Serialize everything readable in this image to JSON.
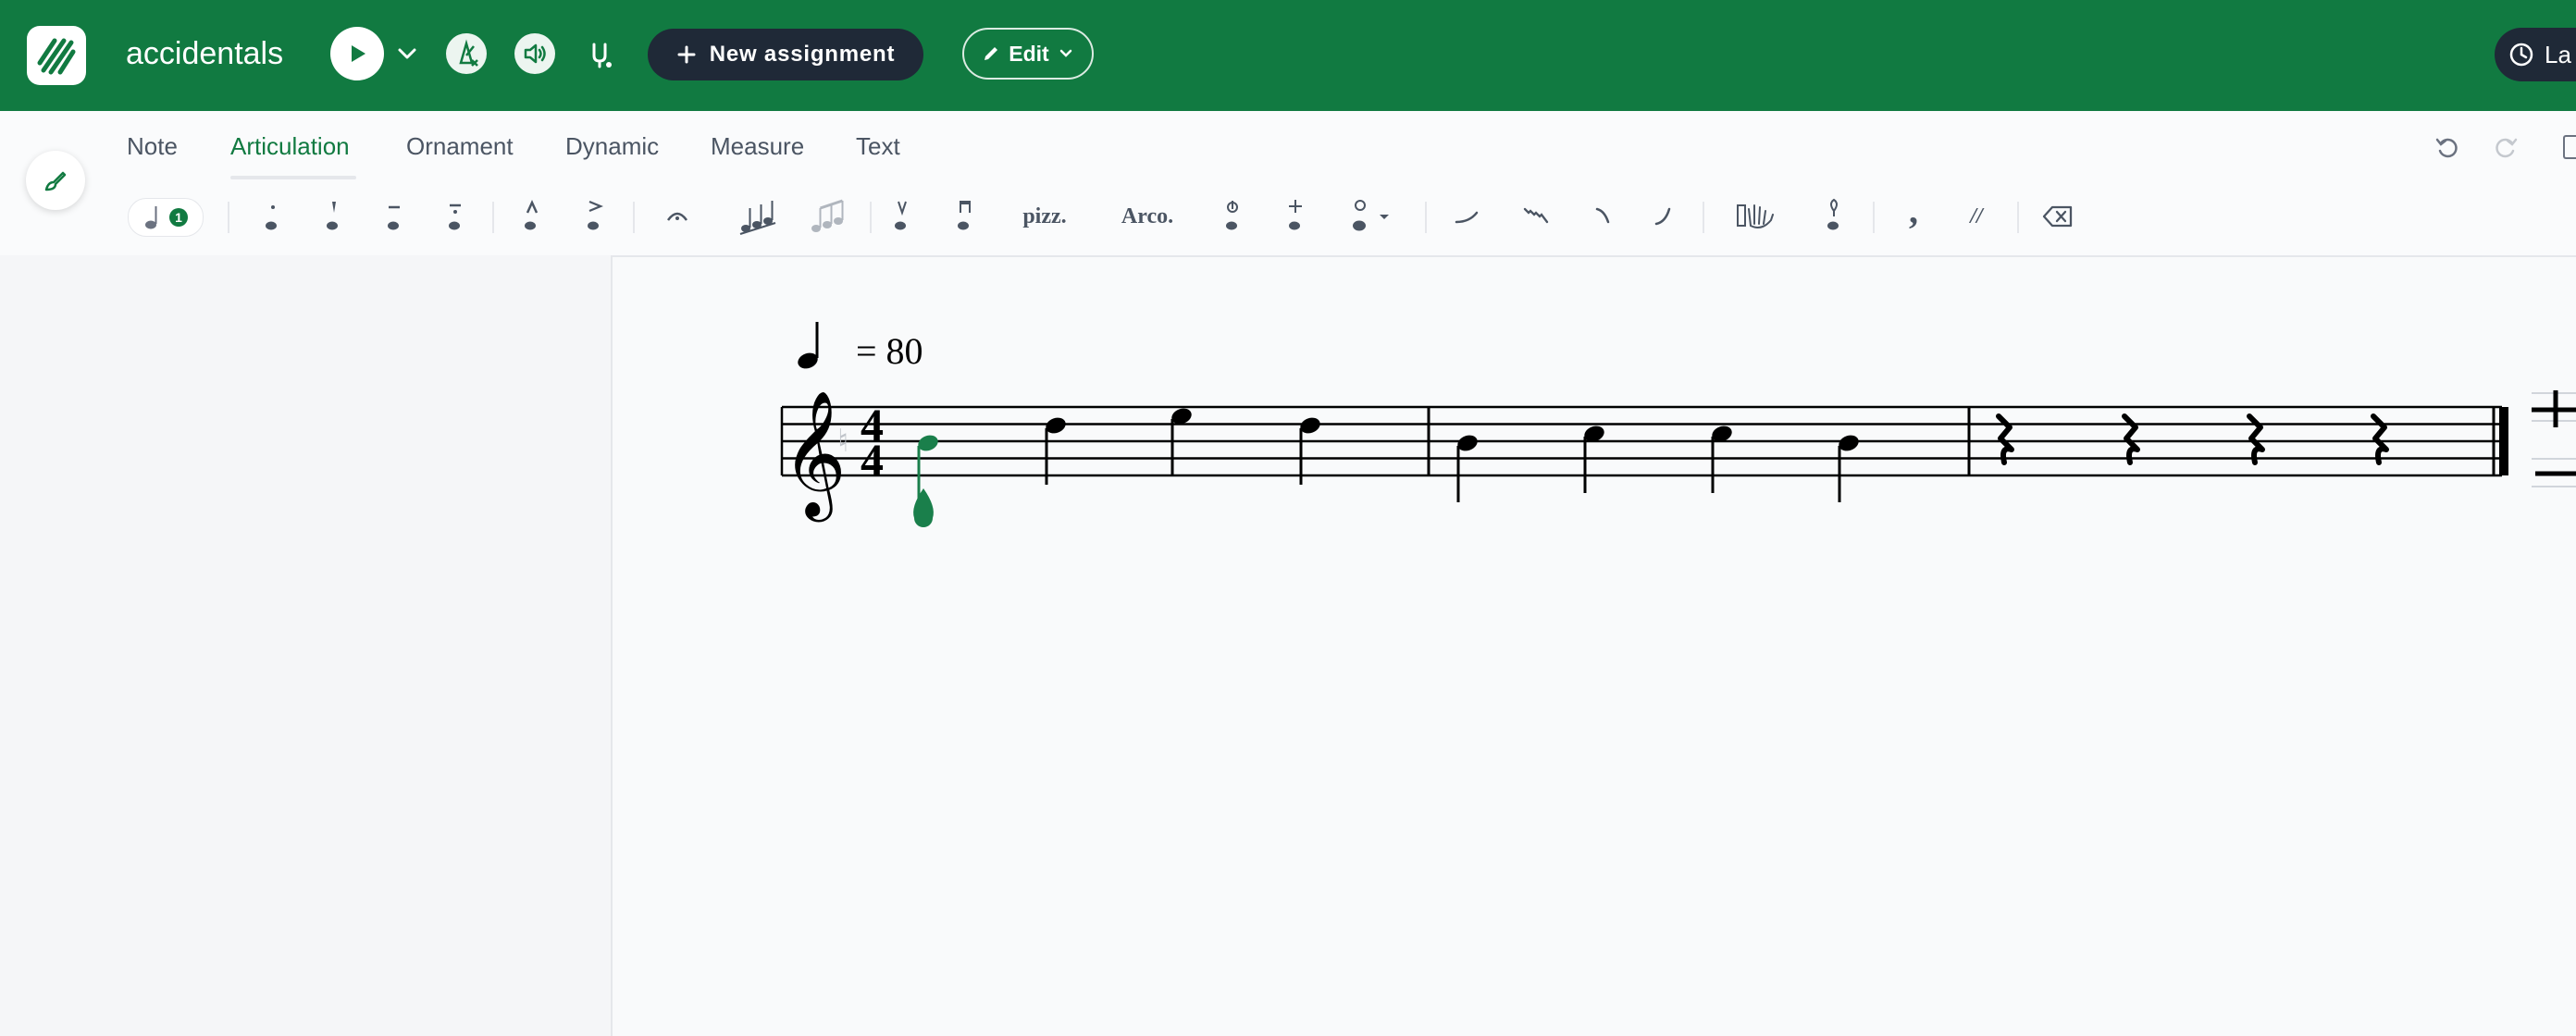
{
  "app": {
    "title": "accidentals"
  },
  "header": {
    "new_assignment_label": "New assignment",
    "edit_label": "Edit",
    "right_pill_label": "La"
  },
  "tabs": [
    {
      "label": "Note",
      "active": false
    },
    {
      "label": "Articulation",
      "active": true
    },
    {
      "label": "Ornament",
      "active": false
    },
    {
      "label": "Dynamic",
      "active": false
    },
    {
      "label": "Measure",
      "active": false
    },
    {
      "label": "Text",
      "active": false
    }
  ],
  "toolbar": {
    "voice_badge": "1",
    "pizz_label": "pizz.",
    "arco_label": "Arco.",
    "comma_label": ",",
    "caesura_label": "//"
  },
  "score": {
    "tempo_value": "= 80",
    "time_signature_top": "4",
    "time_signature_bottom": "4"
  },
  "colors": {
    "brand_green": "#117a41",
    "dark": "#1f2937",
    "selection_green": "#1a7f4b"
  }
}
